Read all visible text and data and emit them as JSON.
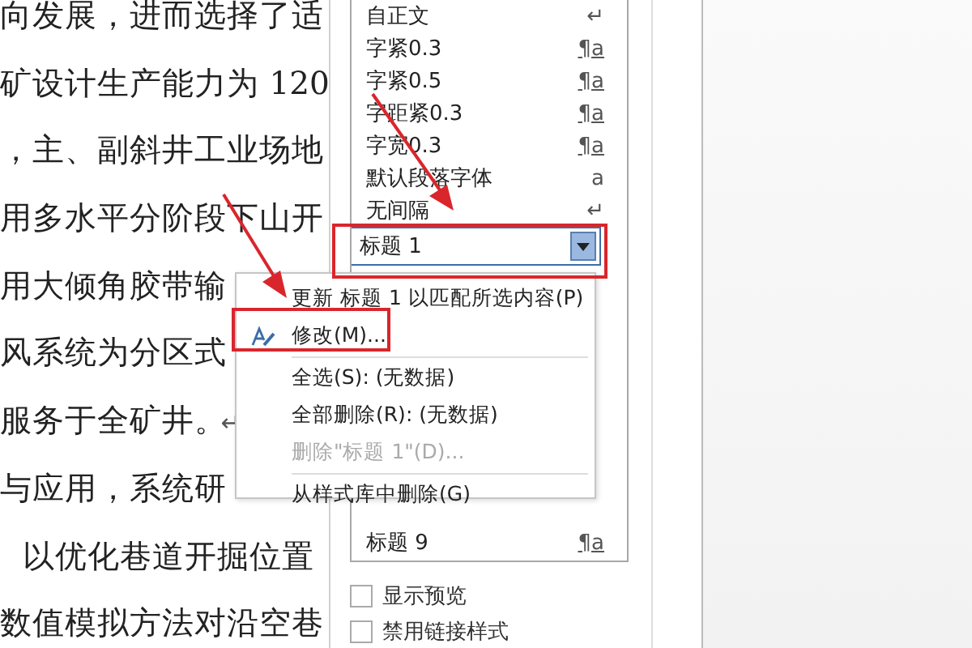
{
  "document": {
    "lines": [
      {
        "text": "向发展，进而选择了适",
        "kind": "line"
      },
      {
        "text": "矿设计生产能力为 120",
        "kind": "line"
      },
      {
        "text": "，主、副斜井工业场地",
        "kind": "line"
      },
      {
        "text": "用多水平分阶段下山开",
        "kind": "line"
      },
      {
        "text": "用大倾角胶带输",
        "kind": "line"
      },
      {
        "text": "风系统为分区式",
        "kind": "line"
      },
      {
        "text": "服务于全矿井。",
        "kind": "line",
        "mark": "↵"
      },
      {
        "text": "与应用，系统研",
        "kind": "line"
      },
      {
        "text": "以优化巷道开掘位置",
        "kind": "indent"
      },
      {
        "text": "数值模拟方法对沿空巷",
        "kind": "line"
      }
    ]
  },
  "styles_pane": {
    "items": [
      {
        "name": "自正文",
        "icon": "↵",
        "selected": false
      },
      {
        "name": "字紧0.3",
        "icon": "¶a",
        "selected": false
      },
      {
        "name": "字紧0.5",
        "icon": "¶a",
        "selected": false
      },
      {
        "name": "字距紧0.3",
        "icon": "¶a",
        "selected": false
      },
      {
        "name": "字宽0.3",
        "icon": "¶a",
        "selected": false
      },
      {
        "name": "默认段落字体",
        "icon": "a",
        "selected": false
      },
      {
        "name": "无间隔",
        "icon": "↵",
        "selected": false
      },
      {
        "name": "标题 1",
        "selected": true
      },
      {
        "name": "标题 9",
        "icon": "¶a",
        "selected": false
      }
    ],
    "checkboxes": [
      {
        "label": "显示预览",
        "checked": false
      },
      {
        "label": "禁用链接样式",
        "checked": false
      }
    ]
  },
  "context_menu": {
    "items": [
      {
        "kind": "command",
        "label": "更新 标题 1 以匹配所选内容(P)",
        "disabled": false,
        "has_icon": false
      },
      {
        "kind": "command",
        "label": "修改(M)...",
        "disabled": false,
        "has_icon": true
      },
      {
        "kind": "separator"
      },
      {
        "kind": "command",
        "label": "全选(S): (无数据)",
        "disabled": false,
        "has_icon": false
      },
      {
        "kind": "command",
        "label": "全部删除(R): (无数据)",
        "disabled": false,
        "has_icon": false
      },
      {
        "kind": "command",
        "label": "删除\"标题 1\"(D)...",
        "disabled": true,
        "has_icon": false
      },
      {
        "kind": "separator"
      },
      {
        "kind": "command",
        "label": "从样式库中删除(G)",
        "disabled": false,
        "has_icon": false
      }
    ]
  }
}
